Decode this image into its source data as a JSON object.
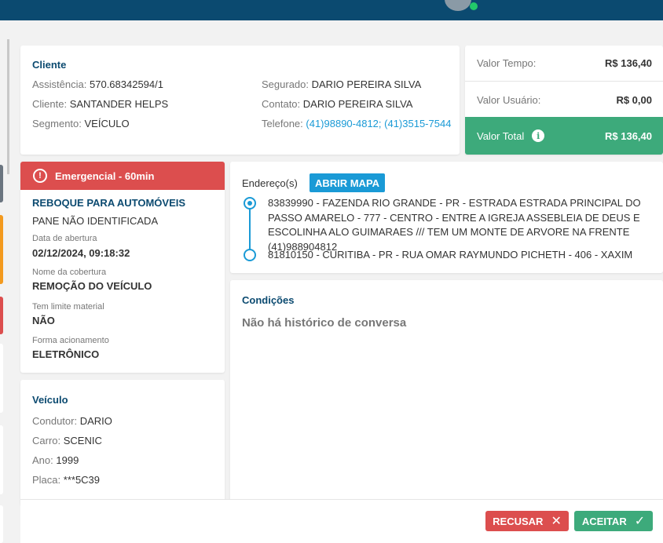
{
  "colors": {
    "header": "#0b4a70",
    "primary_title": "#0b4a70",
    "link": "#1a9ad6",
    "danger": "#dc4e4e",
    "success": "#3daa7b"
  },
  "client": {
    "title": "Cliente",
    "assistencia_label": "Assistência:",
    "assistencia_value": "570.68342594/1",
    "cliente_label": "Cliente:",
    "cliente_value": "SANTANDER HELPS",
    "segmento_label": "Segmento:",
    "segmento_value": "VEÍCULO",
    "segurado_label": "Segurado:",
    "segurado_value": "DARIO PEREIRA SILVA",
    "contato_label": "Contato:",
    "contato_value": "DARIO PEREIRA SILVA",
    "telefone_label": "Telefone:",
    "telefone_value": "(41)98890-4812; (41)3515-7544"
  },
  "values": {
    "tempo_label": "Valor Tempo:",
    "tempo_value": "R$ 136,40",
    "usuario_label": "Valor Usuário:",
    "usuario_value": "R$ 0,00",
    "total_label": "Valor Total",
    "total_value": "R$ 136,40"
  },
  "service": {
    "priority": "Emergencial - 60min",
    "title": "REBOQUE PARA AUTOMÓVEIS",
    "problem": "PANE NÃO IDENTIFICADA",
    "opened_label": "Data de abertura",
    "opened_value": "02/12/2024, 09:18:32",
    "coverage_label": "Nome da cobertura",
    "coverage_value": "REMOÇÃO DO VEÍCULO",
    "material_label": "Tem limite material",
    "material_value": "NÃO",
    "trigger_label": "Forma acionamento",
    "trigger_value": "ELETRÔNICO"
  },
  "vehicle": {
    "title": "Veículo",
    "condutor_label": "Condutor:",
    "condutor_value": "DARIO",
    "carro_label": "Carro:",
    "carro_value": "SCENIC",
    "ano_label": "Ano:",
    "ano_value": "1999",
    "placa_label": "Placa:",
    "placa_value": "***5C39"
  },
  "address": {
    "label": "Endereço(s)",
    "map_button": "ABRIR MAPA",
    "origin": "83839990 - FAZENDA RIO GRANDE - PR - ESTRADA ESTRADA PRINCIPAL DO PASSO AMARELO - 777 - CENTRO - ENTRE A IGREJA ASSEBLEIA DE DEUS E ESCOLINHA ALO GUIMARAES /// TEM UM MONTE DE ARVORE NA FRENTE (41)988904812",
    "destination": "81810150 - CURITIBA - PR - RUA OMAR RAYMUNDO PICHETH - 406 - XAXIM"
  },
  "conditions": {
    "title": "Condições",
    "empty": "Não há histórico de conversa"
  },
  "footer": {
    "refuse": "RECUSAR",
    "accept": "ACEITAR"
  }
}
